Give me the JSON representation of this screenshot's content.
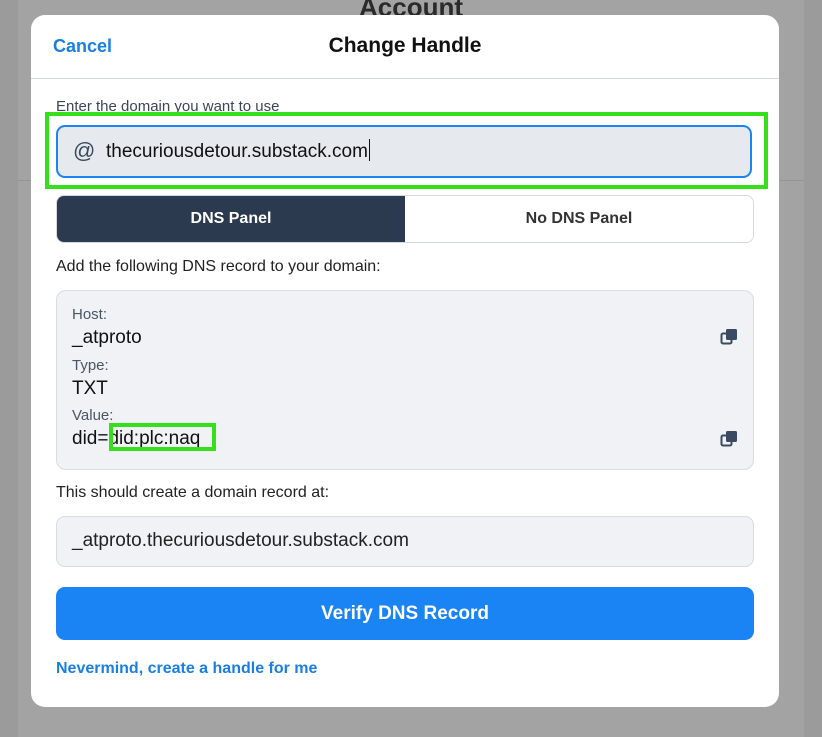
{
  "background": {
    "page_title": "Account"
  },
  "modal": {
    "cancel_label": "Cancel",
    "title": "Change Handle",
    "domain_label": "Enter the domain you want to use",
    "at_symbol": "@",
    "handle_value": "thecuriousdetour.substack.com",
    "tabs": [
      {
        "label": "DNS Panel",
        "active": true
      },
      {
        "label": "No DNS Panel",
        "active": false
      }
    ],
    "instruction": "Add the following DNS record to your domain:",
    "record": {
      "host_label": "Host:",
      "host_value": "_atproto",
      "type_label": "Type:",
      "type_value": "TXT",
      "value_label": "Value:",
      "value_prefix": "did=",
      "value_did": "did:plc:naq"
    },
    "create_label": "This should create a domain record at:",
    "record_at": "_atproto.thecuriousdetour.substack.com",
    "verify_label": "Verify DNS Record",
    "nevermind_label": "Nevermind, create a handle for me"
  },
  "colors": {
    "accent": "#1a84f5",
    "active_tab": "#2b3a4e",
    "highlight": "#35e01a"
  },
  "icons": [
    "at-icon",
    "copy-icon"
  ]
}
